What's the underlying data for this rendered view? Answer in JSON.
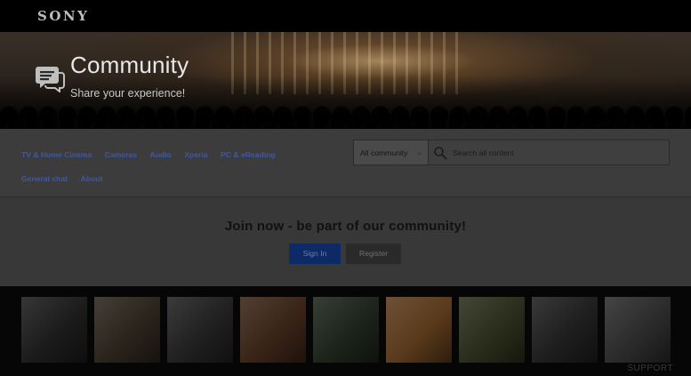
{
  "brand": {
    "logo_text": "SONY"
  },
  "hero": {
    "title": "Community",
    "subtitle": "Share your experience!",
    "icon": "chat-bubble-icon"
  },
  "nav": {
    "items": [
      {
        "label": "TV & Home Cinema"
      },
      {
        "label": "Cameras"
      },
      {
        "label": "Audio"
      },
      {
        "label": "Xperia"
      },
      {
        "label": "PC & eReading"
      },
      {
        "label": "General chat"
      },
      {
        "label": "About"
      }
    ],
    "link_color": "#3f58a5"
  },
  "search": {
    "scope_value": "All community",
    "placeholder": "Search all content",
    "icon": "search-icon"
  },
  "join": {
    "title": "Join now - be part of our community!",
    "sign_in_label": "Sign In",
    "register_label": "Register"
  },
  "gallery": {
    "overlay_text": "SUPPORT",
    "thumbnails": [
      {
        "name": "thumb-1",
        "color": "#1b1b1b"
      },
      {
        "name": "thumb-2",
        "color": "#2a241c"
      },
      {
        "name": "thumb-3",
        "color": "#202020"
      },
      {
        "name": "thumb-4",
        "color": "#3a2418"
      },
      {
        "name": "thumb-5",
        "color": "#1d241b"
      },
      {
        "name": "thumb-6",
        "color": "#5a3a1b"
      },
      {
        "name": "thumb-7",
        "color": "#2a2d1b"
      },
      {
        "name": "thumb-8",
        "color": "#1e1e1e"
      },
      {
        "name": "thumb-9",
        "color": "#2b2b2b"
      }
    ]
  }
}
